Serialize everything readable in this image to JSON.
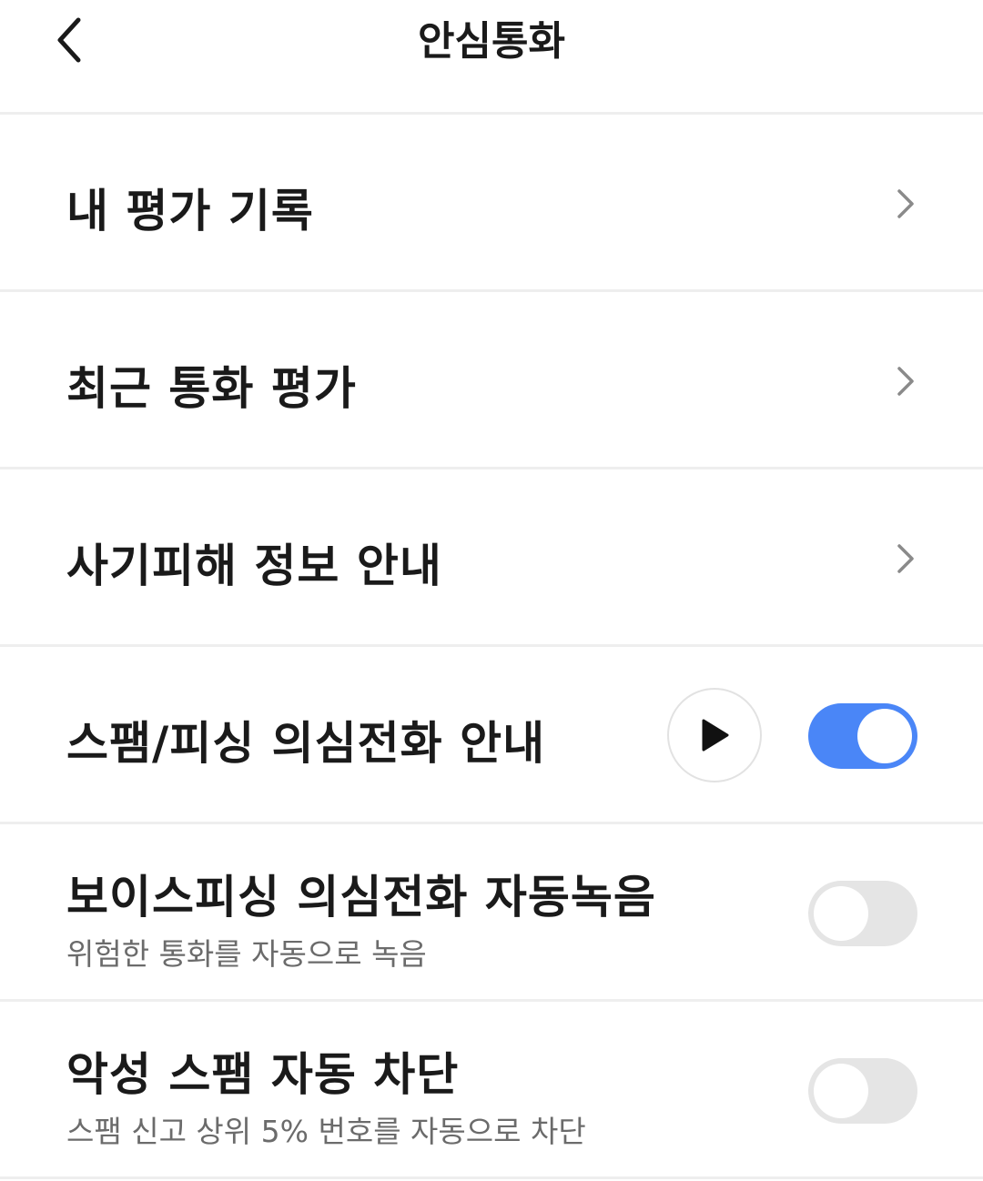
{
  "header": {
    "title": "안심통화"
  },
  "menu": {
    "items": [
      {
        "label": "내 평가 기록"
      },
      {
        "label": "최근 통화 평가"
      },
      {
        "label": "사기피해 정보 안내"
      }
    ]
  },
  "settings": {
    "spam_guide": {
      "label": "스팸/피싱 의심전화 안내",
      "enabled": true
    },
    "auto_record": {
      "label": "보이스피싱 의심전화 자동녹음",
      "description": "위험한 통화를 자동으로 녹음",
      "enabled": false
    },
    "auto_block": {
      "label": "악성 스팸 자동 차단",
      "description": "스팸 신고 상위 5% 번호를 자동으로 차단",
      "enabled": false
    }
  },
  "colors": {
    "toggle_on": "#4a86f7",
    "toggle_off": "#e5e5e5",
    "divider": "#eeeeee"
  },
  "icons": {
    "back": "chevron-left-icon",
    "chevron": "chevron-right-icon",
    "play": "play-icon"
  }
}
